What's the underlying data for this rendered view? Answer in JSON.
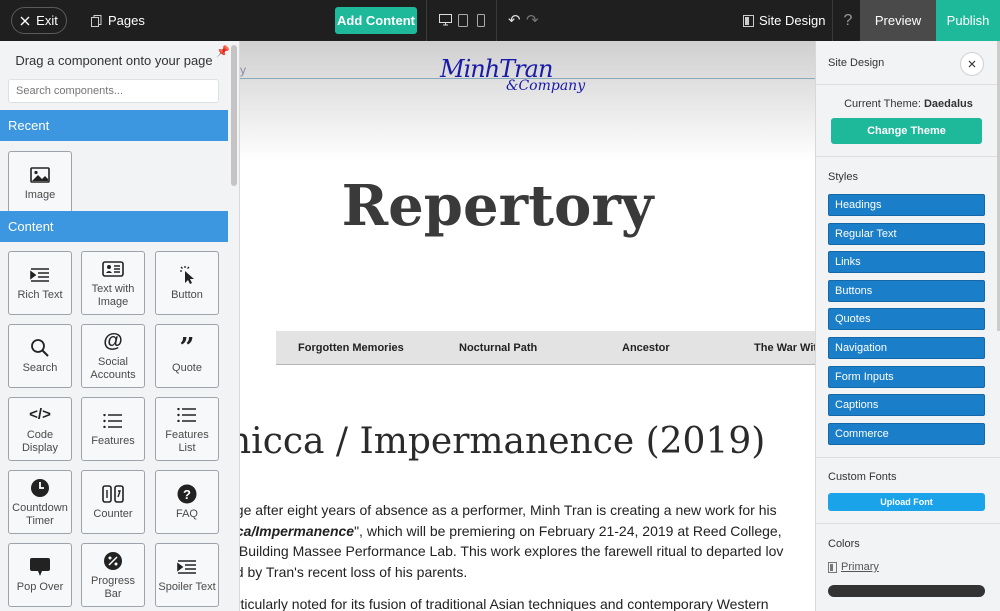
{
  "toolbar": {
    "exit_label": "Exit",
    "pages_label": "Pages",
    "add_content_label": "Add Content",
    "site_design_label": "Site Design",
    "help_label": "?",
    "preview_label": "Preview",
    "publish_label": "Publish",
    "icons": [
      "close-icon",
      "pages-icon",
      "desktop-icon",
      "tablet-icon",
      "mobile-icon",
      "undo-icon",
      "redo-icon",
      "site-design-icon"
    ]
  },
  "left_panel": {
    "title": "Drag a component onto your page",
    "search_placeholder": "Search components...",
    "recent_label": "Recent",
    "content_label": "Content",
    "recent_items": [
      {
        "label": "Image",
        "icon": "image-icon"
      }
    ],
    "content_items": [
      {
        "label": "Rich Text",
        "icon": "rich-text-icon"
      },
      {
        "label": "Text with Image",
        "icon": "text-with-image-icon"
      },
      {
        "label": "Button",
        "icon": "button-cursor-icon"
      },
      {
        "label": "Search",
        "icon": "search-icon"
      },
      {
        "label": "Social Accounts",
        "icon": "at-sign-icon"
      },
      {
        "label": "Quote",
        "icon": "quote-icon"
      },
      {
        "label": "Code Display",
        "icon": "code-icon"
      },
      {
        "label": "Features",
        "icon": "features-list-icon"
      },
      {
        "label": "Features List",
        "icon": "features-list-icon"
      },
      {
        "label": "Countdown Timer",
        "icon": "clock-icon"
      },
      {
        "label": "Counter",
        "icon": "counter-icon"
      },
      {
        "label": "FAQ",
        "icon": "question-icon"
      },
      {
        "label": "Pop Over",
        "icon": "speech-bubble-icon"
      },
      {
        "label": "Progress Bar",
        "icon": "percent-icon"
      },
      {
        "label": "Spoiler Text",
        "icon": "spoiler-icon"
      }
    ]
  },
  "canvas": {
    "logo_line1": "MinhTran",
    "logo_line2": "&Company",
    "stray_char": "y",
    "page_title": "Repertory",
    "nav_items": [
      "Forgotten Memories",
      "Nocturnal Path",
      "Ancestor",
      "The War Wit"
    ],
    "work_title": "nicca / Impermanence (2019)",
    "paragraph": {
      "l1": "age after eight years of absence as a performer, Minh Tran is creating a new work for his",
      "l2_em": "cca/Impermanence",
      "l2_rest": "\", which will be premiering on February 21-24, 2019 at Reed College,",
      "l3": "s Building Massee Performance Lab.  This work explores the farewell ritual to departed lov",
      "l4": "ed by Tran's recent loss of his parents.",
      "l5": "articularly noted for its fusion of traditional Asian techniques and contemporary Western"
    }
  },
  "right_panel": {
    "title": "Site Design",
    "current_theme_prefix": "Current Theme:",
    "current_theme": "Daedalus",
    "change_theme_label": "Change Theme",
    "styles_label": "Styles",
    "styles": [
      "Headings",
      "Regular Text",
      "Links",
      "Buttons",
      "Quotes",
      "Navigation",
      "Form Inputs",
      "Captions",
      "Commerce"
    ],
    "custom_fonts_label": "Custom Fonts",
    "upload_font_label": "Upload Font",
    "colors_label": "Colors",
    "primary_label": "Primary",
    "primary_color": "#333333"
  },
  "colors": {
    "accent": "#1eb99a",
    "section_blue": "#3d97e0",
    "style_blue": "#1b7ec9",
    "topbar": "#1f1f1f"
  }
}
